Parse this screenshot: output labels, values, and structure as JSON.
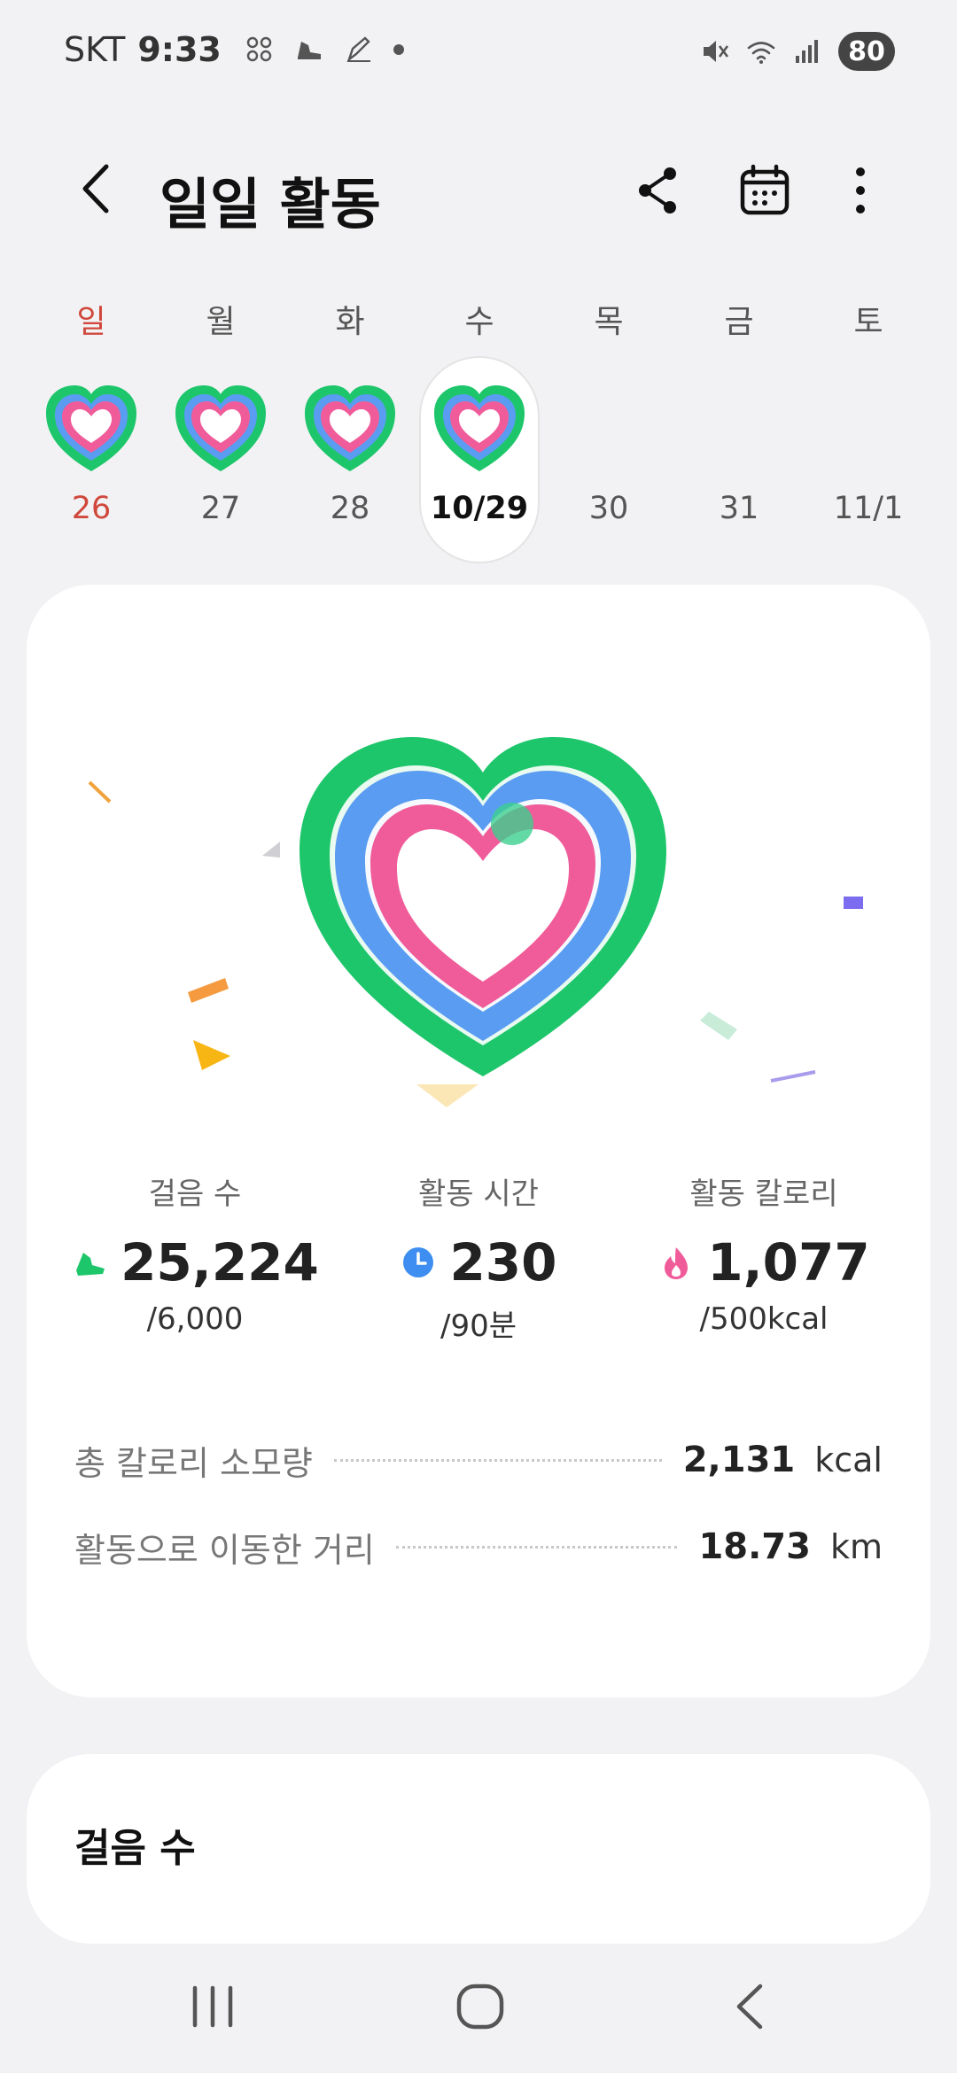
{
  "status_bar": {
    "carrier": "SKT",
    "time": "9:33",
    "battery": "80"
  },
  "header": {
    "title": "일일 활동"
  },
  "week": [
    {
      "name": "일",
      "date": "26",
      "has_ring": true,
      "sunday": true
    },
    {
      "name": "월",
      "date": "27",
      "has_ring": true
    },
    {
      "name": "화",
      "date": "28",
      "has_ring": true
    },
    {
      "name": "수",
      "date": "10/29",
      "has_ring": true,
      "selected": true
    },
    {
      "name": "목",
      "date": "30",
      "has_ring": false
    },
    {
      "name": "금",
      "date": "31",
      "has_ring": false
    },
    {
      "name": "토",
      "date": "11/1",
      "has_ring": false
    }
  ],
  "stats": {
    "steps": {
      "label": "걸음 수",
      "value": "25,224",
      "goal": "/6,000"
    },
    "active_time": {
      "label": "활동 시간",
      "value": "230",
      "goal": "/90분"
    },
    "active_calories": {
      "label": "활동 칼로리",
      "value": "1,077",
      "goal": "/500kcal"
    }
  },
  "summary": {
    "total_calories": {
      "label": "총 칼로리 소모량",
      "value": "2,131",
      "unit": "kcal"
    },
    "distance": {
      "label": "활동으로 이동한 거리",
      "value": "18.73",
      "unit": "km"
    }
  },
  "steps_card": {
    "title": "걸음 수"
  },
  "colors": {
    "ring_green": "#1ec66b",
    "ring_blue": "#5a9cf2",
    "ring_pink": "#f05c9a",
    "sunday_red": "#d0483c",
    "background": "#f2f2f4"
  },
  "icons": {
    "back": "chevron-left-icon",
    "share": "share-icon",
    "calendar": "calendar-icon",
    "more": "more-vertical-icon",
    "steps": "shoe-icon",
    "time": "clock-icon",
    "calories": "flame-icon"
  }
}
